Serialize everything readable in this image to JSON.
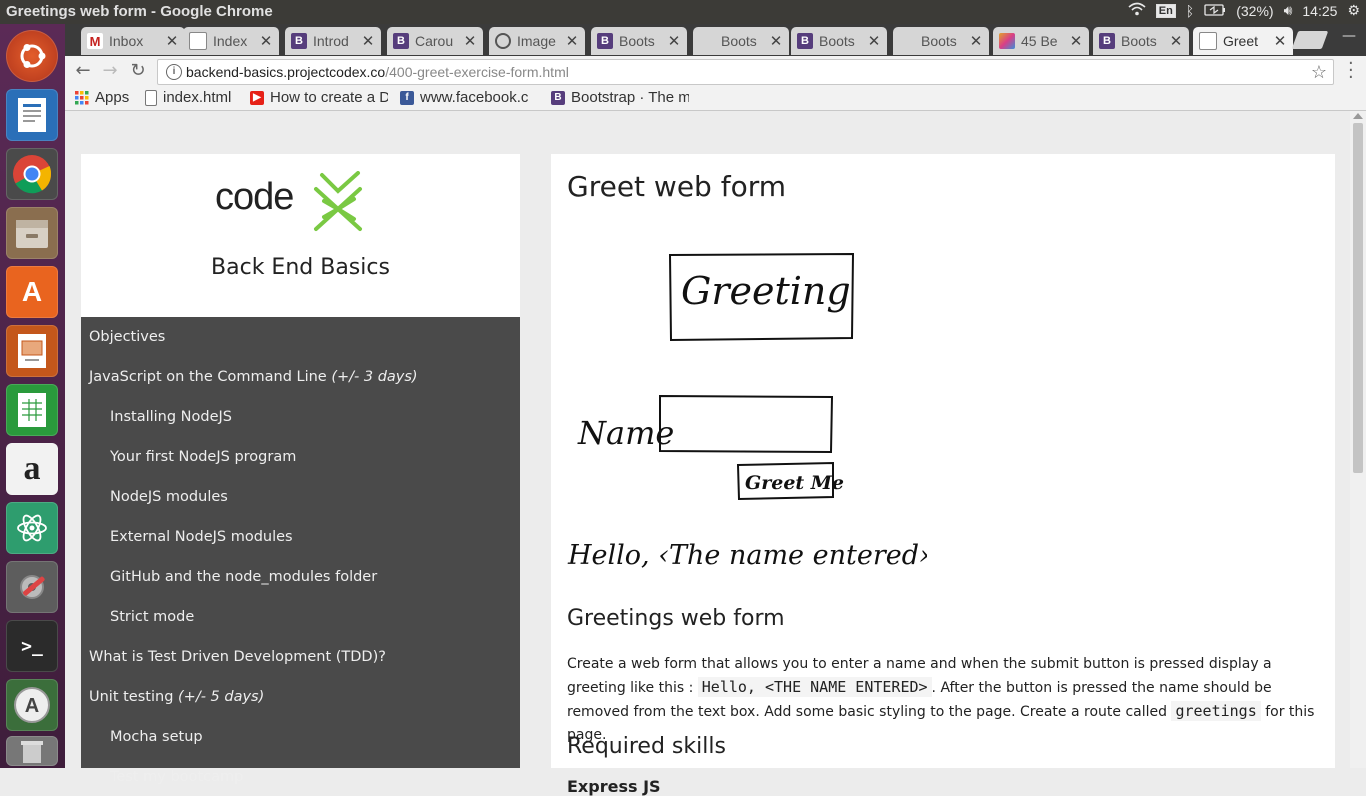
{
  "window": {
    "title": "Greetings web form - Google Chrome"
  },
  "tray": {
    "keyboard": "En",
    "battery": "(32%)",
    "time": "14:25"
  },
  "launcher": [
    "ubuntu-dash",
    "libreoffice-writer",
    "google-chrome",
    "files",
    "ubuntu-software",
    "libreoffice-impress",
    "libreoffice-calc",
    "amazon",
    "atom",
    "system-settings",
    "terminal",
    "software-updater",
    "trash"
  ],
  "tabs": [
    {
      "label": "Inbox",
      "icon": "gmail-icon",
      "color": "#c5221f",
      "glyph": "M"
    },
    {
      "label": "Index",
      "icon": "page-icon",
      "color": "#888888",
      "glyph": ""
    },
    {
      "label": "Introd",
      "icon": "bootstrap-icon",
      "color": "#563d7c",
      "glyph": "B"
    },
    {
      "label": "Carou",
      "icon": "bootstrap-icon",
      "color": "#563d7c",
      "glyph": "B"
    },
    {
      "label": "Image",
      "icon": "image-icon",
      "color": "#555555",
      "glyph": ""
    },
    {
      "label": "Boots",
      "icon": "bootstrap-icon",
      "color": "#563d7c",
      "glyph": "B"
    },
    {
      "label": "Boots",
      "icon": "none",
      "color": "",
      "glyph": ""
    },
    {
      "label": "Boots",
      "icon": "bootstrap-icon",
      "color": "#563d7c",
      "glyph": "B"
    },
    {
      "label": "Boots",
      "icon": "none",
      "color": "",
      "glyph": ""
    },
    {
      "label": "45 Be",
      "icon": "colorful-icon",
      "color": "#e2a32a",
      "glyph": ""
    },
    {
      "label": "Boots",
      "icon": "bootstrap-icon",
      "color": "#563d7c",
      "glyph": "B"
    },
    {
      "label": "Greet",
      "icon": "page-icon",
      "color": "#888888",
      "glyph": ""
    }
  ],
  "omnibox": {
    "host": "backend-basics.projectcodex.co",
    "path": "/400-greet-exercise-form.html"
  },
  "bookmarks": [
    {
      "label": "Apps",
      "icon": "apps-grid-icon"
    },
    {
      "label": "index.html",
      "icon": "page-icon"
    },
    {
      "label": "How to create a D",
      "icon": "youtube-icon"
    },
    {
      "label": "www.facebook.c",
      "icon": "facebook-icon"
    },
    {
      "label": "Bootstrap · The m",
      "icon": "bootstrap-icon"
    }
  ],
  "sidebar": {
    "logo_text": "code",
    "course_title": "Back End Basics",
    "items": [
      {
        "label": "Objectives",
        "hint": "",
        "sub": false
      },
      {
        "label": "JavaScript on the Command Line ",
        "hint": "(+/- 3 days)",
        "sub": false
      },
      {
        "label": "Installing NodeJS",
        "hint": "",
        "sub": true
      },
      {
        "label": "Your first NodeJS program",
        "hint": "",
        "sub": true
      },
      {
        "label": "NodeJS modules",
        "hint": "",
        "sub": true
      },
      {
        "label": "External NodeJS modules",
        "hint": "",
        "sub": true
      },
      {
        "label": "GitHub and the node_modules folder",
        "hint": "",
        "sub": true
      },
      {
        "label": "Strict mode",
        "hint": "",
        "sub": true
      },
      {
        "label": "What is Test Driven Development (TDD)?",
        "hint": "",
        "sub": false
      },
      {
        "label": "Unit testing ",
        "hint": "(+/- 5 days)",
        "sub": false
      },
      {
        "label": "Mocha setup",
        "hint": "",
        "sub": true
      },
      {
        "label": "Test my bootcamp",
        "hint": "",
        "sub": true
      }
    ]
  },
  "content": {
    "title": "Greet web form",
    "sketch": {
      "heading_box": "Greeting",
      "name_label": "Name",
      "button_label": "Greet Me",
      "output": "Hello,  ‹The name entered›"
    },
    "section_title": "Greetings web form",
    "para_1": "Create a web form that allows you to enter a name and when the submit button is pressed display a greeting like this : ",
    "code_1": "Hello, <THE NAME ENTERED>",
    "para_2": ". After the button is pressed the name should be removed from the text box. Add some basic styling to the page. Create a route called ",
    "code_2": "greetings",
    "para_3": " for this page.",
    "skills_title": "Required skills",
    "skills_sub": "Express JS"
  }
}
